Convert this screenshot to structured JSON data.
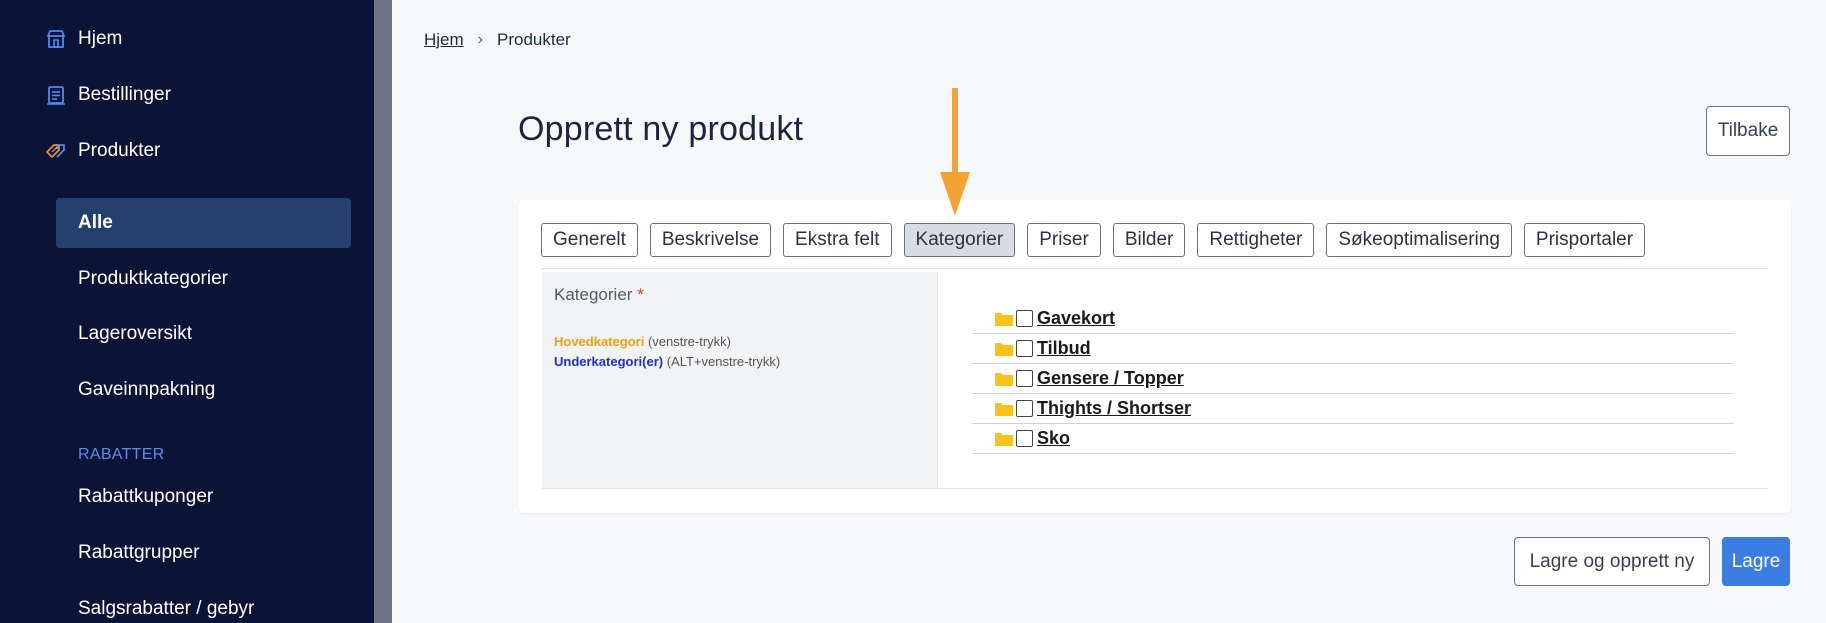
{
  "sidebar": {
    "top_items": [
      {
        "label": "Hjem",
        "icon": "store-icon"
      },
      {
        "label": "Bestillinger",
        "icon": "order-list-icon"
      },
      {
        "label": "Produkter",
        "icon": "tags-icon"
      }
    ],
    "sub_items": [
      {
        "label": "Alle",
        "active": true
      },
      {
        "label": "Produktkategorier"
      },
      {
        "label": "Lageroversikt"
      },
      {
        "label": "Gaveinnpakning"
      }
    ],
    "section_label": "RABATTER",
    "rabatt_items": [
      {
        "label": "Rabattkuponger"
      },
      {
        "label": "Rabattgrupper"
      },
      {
        "label": "Salgsrabatter / gebyr"
      }
    ]
  },
  "breadcrumb": {
    "home": "Hjem",
    "current": "Produkter"
  },
  "page": {
    "title": "Opprett ny produkt",
    "back_label": "Tilbake"
  },
  "tabs": [
    {
      "label": "Generelt"
    },
    {
      "label": "Beskrivelse"
    },
    {
      "label": "Ekstra felt"
    },
    {
      "label": "Kategorier",
      "active": true
    },
    {
      "label": "Priser"
    },
    {
      "label": "Bilder"
    },
    {
      "label": "Rettigheter"
    },
    {
      "label": "Søkeoptimalisering"
    },
    {
      "label": "Prisportaler"
    }
  ],
  "categories": {
    "label": "Kategorier",
    "required_mark": "*",
    "hint_main": "Hovedkategori",
    "hint_main_action": "(venstre-trykk)",
    "hint_sub": "Underkategori(er)",
    "hint_sub_action": "(ALT+venstre-trykk)",
    "items": [
      "Gavekort",
      "Tilbud",
      "Gensere / Topper",
      "Thights / Shortser",
      "Sko"
    ]
  },
  "actions": {
    "save_new": "Lagre og opprett ny",
    "save": "Lagre"
  },
  "colors": {
    "sidebar_bg": "#0b1437",
    "active_item": "#24406e",
    "section_label": "#5b8de8",
    "primary": "#3b7de0",
    "arrow": "#f4a234",
    "folder": "#f7c31a"
  }
}
